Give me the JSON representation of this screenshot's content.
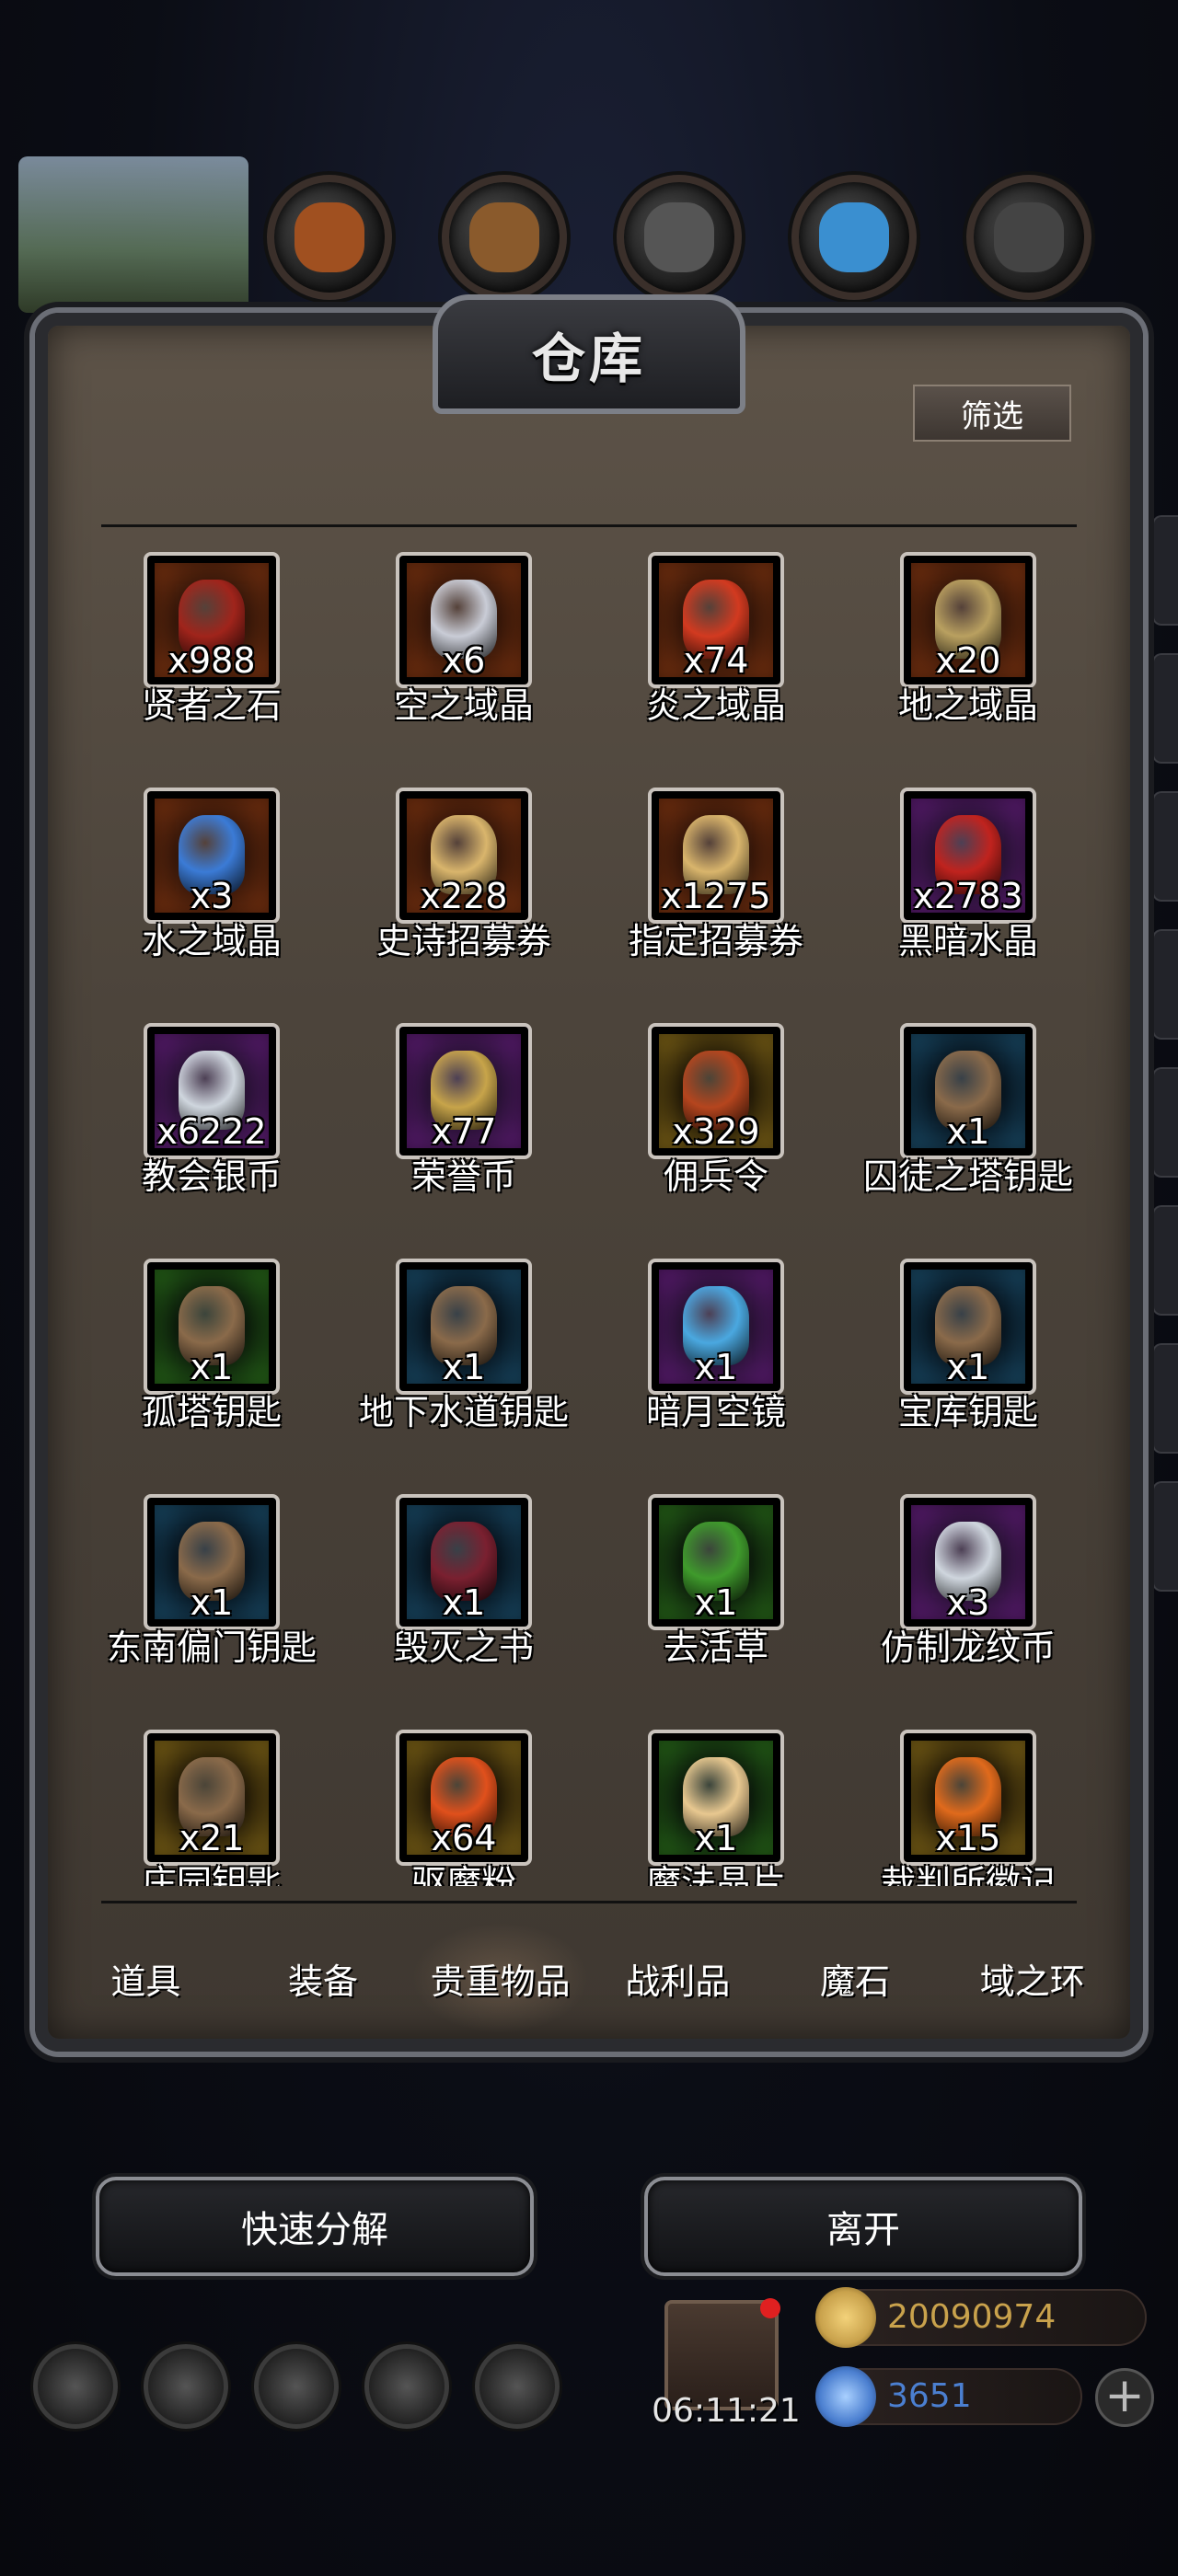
{
  "window": {
    "title": "仓库",
    "filter_label": "筛选"
  },
  "top_categories": [
    {
      "icon": "ore-sack-icon",
      "color": "#a05020"
    },
    {
      "icon": "wood-planks-icon",
      "color": "#8a5a2c"
    },
    {
      "icon": "stone-blocks-icon",
      "color": "#555555"
    },
    {
      "icon": "crystal-icon",
      "color": "#3a8fd0"
    },
    {
      "icon": "iron-ingot-icon",
      "color": "#444444"
    }
  ],
  "items": [
    {
      "name": "贤者之石",
      "count": "x988",
      "rarity": "orange",
      "art": "#a0241b"
    },
    {
      "name": "空之域晶",
      "count": "x6",
      "rarity": "orange",
      "art": "#c9ccd6"
    },
    {
      "name": "炎之域晶",
      "count": "x74",
      "rarity": "orange",
      "art": "#d23a20"
    },
    {
      "name": "地之域晶",
      "count": "x20",
      "rarity": "orange",
      "art": "#b9a060"
    },
    {
      "name": "水之域晶",
      "count": "x3",
      "rarity": "orange",
      "art": "#3b7bd6"
    },
    {
      "name": "史诗招募券",
      "count": "x228",
      "rarity": "orange",
      "art": "#d9b56c"
    },
    {
      "name": "指定招募券",
      "count": "x1275",
      "rarity": "orange",
      "art": "#d9b56c"
    },
    {
      "name": "黑暗水晶",
      "count": "x2783",
      "rarity": "purple",
      "art": "#c0231e"
    },
    {
      "name": "教会银币",
      "count": "x6222",
      "rarity": "purple",
      "art": "#cfd6de"
    },
    {
      "name": "荣誉币",
      "count": "x77",
      "rarity": "purple",
      "art": "#c7a44a"
    },
    {
      "name": "佣兵令",
      "count": "x329",
      "rarity": "gold",
      "art": "#b5451e"
    },
    {
      "name": "囚徒之塔钥匙",
      "count": "x1",
      "rarity": "blue",
      "art": "#8a6a4a"
    },
    {
      "name": "孤塔钥匙",
      "count": "x1",
      "rarity": "green",
      "art": "#8a6a4a"
    },
    {
      "name": "地下水道钥匙",
      "count": "x1",
      "rarity": "blue",
      "art": "#8a6a4a"
    },
    {
      "name": "暗月空镜",
      "count": "x1",
      "rarity": "purple",
      "art": "#4aa8e0"
    },
    {
      "name": "宝库钥匙",
      "count": "x1",
      "rarity": "blue",
      "art": "#8a6a4a"
    },
    {
      "name": "东南偏门钥匙",
      "count": "x1",
      "rarity": "blue",
      "art": "#8a6a4a"
    },
    {
      "name": "毁灭之书",
      "count": "x1",
      "rarity": "blue",
      "art": "#7a2030"
    },
    {
      "name": "去活草",
      "count": "x1",
      "rarity": "green",
      "art": "#3f9a2c"
    },
    {
      "name": "仿制龙纹币",
      "count": "x3",
      "rarity": "purple",
      "art": "#cfd6de"
    },
    {
      "name": "庄园钥匙",
      "count": "x21",
      "rarity": "gold",
      "art": "#8a6a4a"
    },
    {
      "name": "驱魔粉",
      "count": "x64",
      "rarity": "gold",
      "art": "#e0501c"
    },
    {
      "name": "魔法晶片",
      "count": "x1",
      "rarity": "green",
      "art": "#e8c890"
    },
    {
      "name": "裁判所徽记",
      "count": "x15",
      "rarity": "gold",
      "art": "#e06a1c"
    }
  ],
  "tabs": [
    {
      "label": "道具",
      "active": false
    },
    {
      "label": "装备",
      "active": false
    },
    {
      "label": "贵重物品",
      "active": true
    },
    {
      "label": "战利品",
      "active": false
    },
    {
      "label": "魔石",
      "active": false
    },
    {
      "label": "域之环",
      "active": false
    }
  ],
  "actions": {
    "decompose_label": "快速分解",
    "leave_label": "离开"
  },
  "hud": {
    "timer": "06:11:21",
    "gold": "20090974",
    "gems": "3651",
    "gold_color": "#c9a24c",
    "gem_color": "#4b7fd0"
  }
}
